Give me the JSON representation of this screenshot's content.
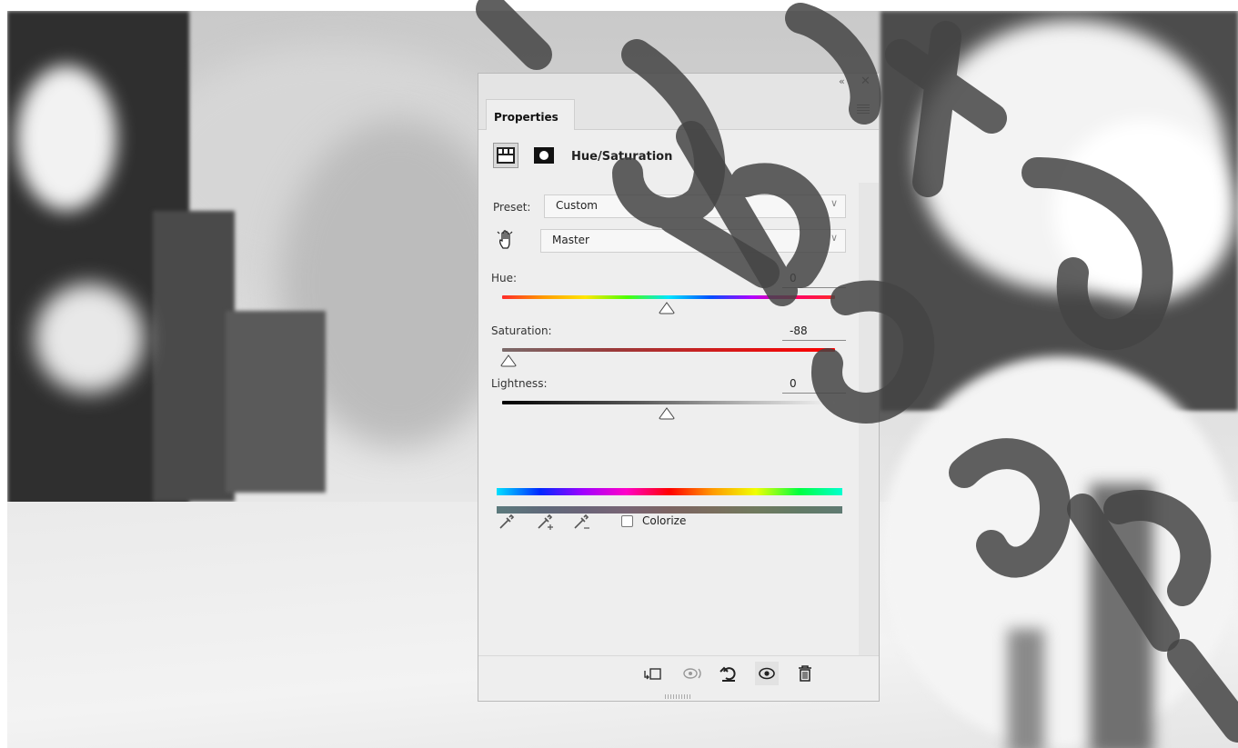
{
  "panel": {
    "tab_label": "Properties",
    "adjustment_title": "Hue/Saturation",
    "preset_label": "Preset:",
    "preset_value": "Custom",
    "channel_value": "Master",
    "hue": {
      "label": "Hue:",
      "value": "0"
    },
    "saturation": {
      "label": "Saturation:",
      "value": "-88"
    },
    "lightness": {
      "label": "Lightness:",
      "value": "0"
    },
    "colorize_label": "Colorize",
    "colorize_checked": false
  },
  "icons": {
    "collapse": "double-chevron-left-icon",
    "close": "close-icon",
    "menu": "panel-menu-icon",
    "adjustment": "hue-saturation-adjustment-icon",
    "mask": "layer-mask-icon",
    "target": "targeted-adjustment-hand-icon",
    "eyedropper": "eyedropper-icon",
    "eyedropper_add": "eyedropper-add-icon",
    "eyedropper_subtract": "eyedropper-subtract-icon",
    "clip": "clip-to-layer-icon",
    "view_previous": "view-previous-state-icon",
    "reset": "reset-icon",
    "visibility": "eye-icon",
    "delete": "trash-icon"
  }
}
